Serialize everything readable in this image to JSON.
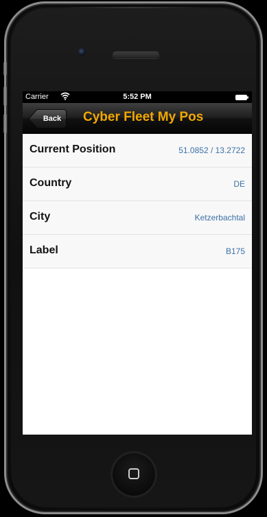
{
  "status_bar": {
    "carrier": "Carrier",
    "time": "5:52 PM"
  },
  "nav_bar": {
    "back_label": "Back",
    "title": "Cyber Fleet My Pos"
  },
  "rows": [
    {
      "label": "Current Position",
      "value": "51.0852 / 13.2722"
    },
    {
      "label": "Country",
      "value": "DE"
    },
    {
      "label": "City",
      "value": "Ketzerbachtal"
    },
    {
      "label": "Label",
      "value": "B175"
    }
  ],
  "colors": {
    "title": "#f2a800",
    "value": "#3b6fa8"
  },
  "icons": {
    "wifi": "wifi-icon",
    "battery": "battery-icon",
    "home": "home-button-icon"
  }
}
